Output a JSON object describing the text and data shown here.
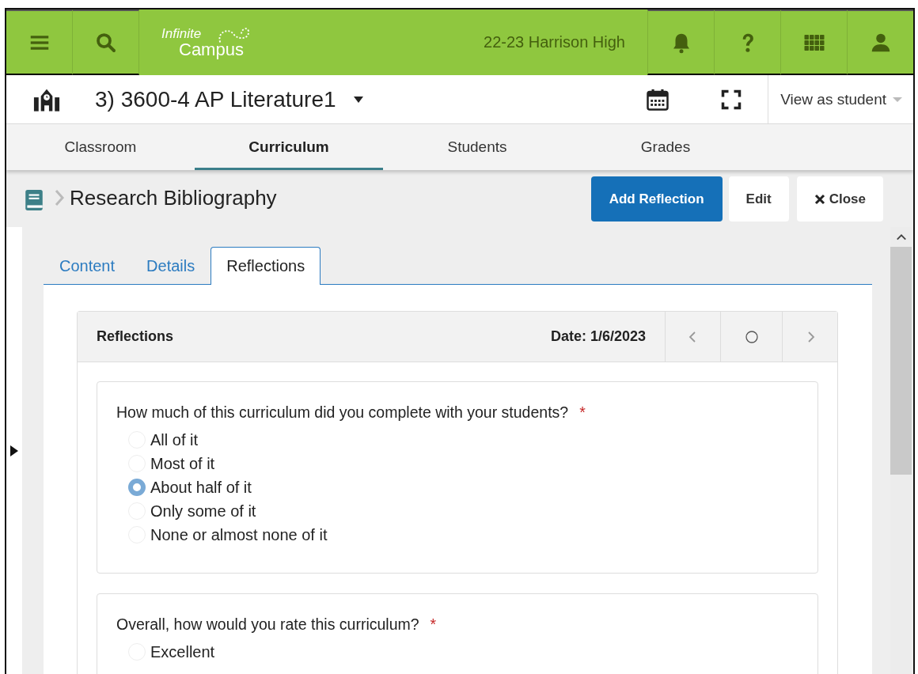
{
  "topbar": {
    "logo": {
      "line_1": "Infinite",
      "line_2": "Campus"
    },
    "school_year": "22-23 Harrison High"
  },
  "course": {
    "title": "3) 3600-4 AP Literature1",
    "view_mode": "View as student"
  },
  "nav_tabs": [
    {
      "label": "Classroom",
      "selected": false
    },
    {
      "label": "Curriculum",
      "selected": true
    },
    {
      "label": "Students",
      "selected": false
    },
    {
      "label": "Grades",
      "selected": false
    }
  ],
  "breadcrumb": {
    "title": "Research Bibliography"
  },
  "actions": [
    {
      "label": "Add Reflection",
      "kind": "primary"
    },
    {
      "label": "Edit",
      "kind": "plain"
    },
    {
      "label": "Close",
      "kind": "close"
    }
  ],
  "sub_tabs": [
    {
      "label": "Content",
      "selected": false
    },
    {
      "label": "Details",
      "selected": false
    },
    {
      "label": "Reflections",
      "selected": true
    }
  ],
  "reflections": {
    "title": "Reflections",
    "date": "Date: 1/6/2023",
    "questions": [
      {
        "text": "How much of this curriculum did you complete with your students?",
        "required_mark": "*",
        "options": [
          {
            "label": "All of it",
            "selected": false
          },
          {
            "label": "Most of it",
            "selected": false
          },
          {
            "label": "About half of it",
            "selected": true
          },
          {
            "label": "Only some of it",
            "selected": false
          },
          {
            "label": "None or almost none of it",
            "selected": false
          }
        ]
      },
      {
        "text": "Overall, how would you rate this curriculum?",
        "required_mark": "*",
        "options": [
          {
            "label": "Excellent",
            "selected": false
          }
        ]
      }
    ]
  }
}
